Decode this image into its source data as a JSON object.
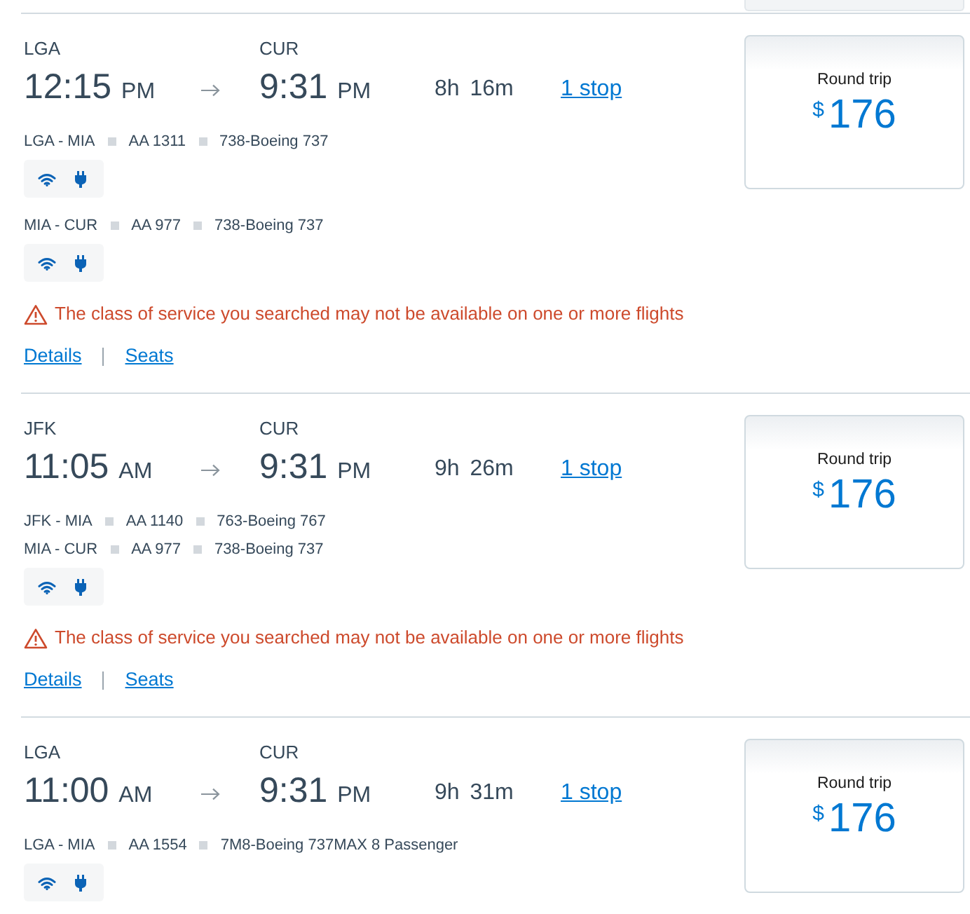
{
  "flights": [
    {
      "origin": "LGA",
      "departure": {
        "time": "12:15",
        "period": "PM"
      },
      "destination": "CUR",
      "arrival": {
        "time": "9:31",
        "period": "PM"
      },
      "duration": "8h 16m",
      "stops": "1 stop",
      "legs": [
        {
          "kind": "segment",
          "route": "LGA - MIA",
          "flight": "AA 1311",
          "aircraft": "738-Boeing 737"
        },
        {
          "kind": "amenities"
        },
        {
          "kind": "segment",
          "route": "MIA - CUR",
          "flight": "AA 977",
          "aircraft": "738-Boeing 737"
        },
        {
          "kind": "amenities"
        }
      ],
      "warning": "The class of service you searched may not be available on one or more flights",
      "links": [
        "Details",
        "Seats"
      ],
      "fare": {
        "label": "Round trip",
        "currency": "$",
        "amount": "176"
      }
    },
    {
      "origin": "JFK",
      "departure": {
        "time": "11:05",
        "period": "AM"
      },
      "destination": "CUR",
      "arrival": {
        "time": "9:31",
        "period": "PM"
      },
      "duration": "9h 26m",
      "stops": "1 stop",
      "legs": [
        {
          "kind": "segment",
          "route": "JFK - MIA",
          "flight": "AA 1140",
          "aircraft": "763-Boeing 767"
        },
        {
          "kind": "segment",
          "route": "MIA - CUR",
          "flight": "AA 977",
          "aircraft": "738-Boeing 737"
        },
        {
          "kind": "amenities"
        }
      ],
      "warning": "The class of service you searched may not be available on one or more flights",
      "links": [
        "Details",
        "Seats"
      ],
      "fare": {
        "label": "Round trip",
        "currency": "$",
        "amount": "176"
      }
    },
    {
      "origin": "LGA",
      "departure": {
        "time": "11:00",
        "period": "AM"
      },
      "destination": "CUR",
      "arrival": {
        "time": "9:31",
        "period": "PM"
      },
      "duration": "9h 31m",
      "stops": "1 stop",
      "legs": [
        {
          "kind": "segment",
          "route": "LGA - MIA",
          "flight": "AA 1554",
          "aircraft": "7M8-Boeing 737MAX 8 Passenger"
        },
        {
          "kind": "amenities"
        }
      ],
      "fare": {
        "label": "Round trip",
        "currency": "$",
        "amount": "176"
      }
    }
  ]
}
